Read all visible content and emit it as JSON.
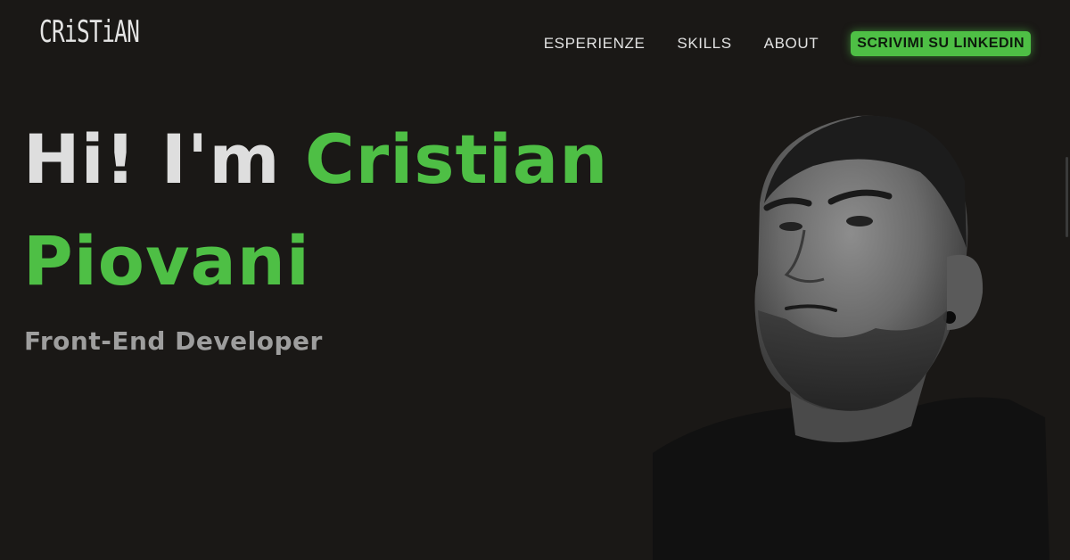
{
  "header": {
    "logo_text": "CRiSTiAN",
    "nav": [
      "ESPERIENZE",
      "SKILLS",
      "ABOUT"
    ],
    "cta_label": "SCRIVIMI SU LINKEDIN"
  },
  "hero": {
    "greeting": "Hi! I'm",
    "first_name": "Cristian",
    "last_name": "Piovani",
    "role": "Front-End Developer"
  },
  "portrait": {
    "icon": "person-portrait"
  },
  "colors": {
    "background": "#1a1816",
    "accent": "#4ebf45",
    "text": "#dedede",
    "muted": "#9e9e9e"
  }
}
